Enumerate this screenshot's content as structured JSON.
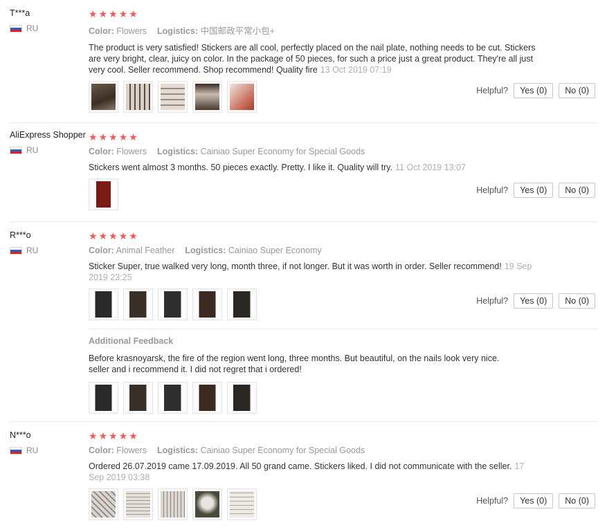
{
  "labels": {
    "color": "Color:",
    "logistics": "Logistics:",
    "helpful": "Helpful?",
    "yes": "Yes (0)",
    "no": "No (0)",
    "additional_feedback": "Additional Feedback"
  },
  "reviews": [
    {
      "user": "T***a",
      "country": "RU",
      "rating": 5,
      "color": "Flowers",
      "logistics": "中国邮政平常小包+",
      "text": "The product is very satisfied! Stickers are all cool, perfectly placed on the nail plate, nothing needs to be cut. Stickers are very bright, clear, juicy on color. In the package of 50 pieces, for such a price just a great product. They're all just very cool. Seller recommend. Shop recommend! Quality fire",
      "date": "13 Oct 2019 07:19",
      "photos": 5
    },
    {
      "user": "AliExpress Shopper",
      "country": "RU",
      "rating": 5,
      "color": "Flowers",
      "logistics": "Cainiao Super Economy for Special Goods",
      "text": "Stickers went almost 3 months. 50 pieces exactly. Pretty. I like it. Quality will try.",
      "date": "11 Oct 2019 13:07",
      "photos": 1
    },
    {
      "user": "R***o",
      "country": "RU",
      "rating": 5,
      "color": "Animal Feather",
      "logistics": "Cainiao Super Economy",
      "text": "Sticker Super, true walked very long, month three, if not longer. But it was worth in order. Seller recommend!",
      "date": "19 Sep 2019 23:25",
      "photos": 5,
      "additional_text": "Before krasnoyarsk, the fire of the region went long, three months. But beautiful, on the nails look very nice. seller and i recommend it. I did not regret that i ordered!",
      "additional_photos": 5
    },
    {
      "user": "N***o",
      "country": "RU",
      "rating": 5,
      "color": "Flowers",
      "logistics": "Cainiao Super Economy for Special Goods",
      "text": "Ordered 26.07.2019 came 17.09.2019. All 50 grand came. Stickers liked. I did not communicate with the seller.",
      "date": "17 Sep 2019 03:38",
      "photos": 5
    }
  ]
}
